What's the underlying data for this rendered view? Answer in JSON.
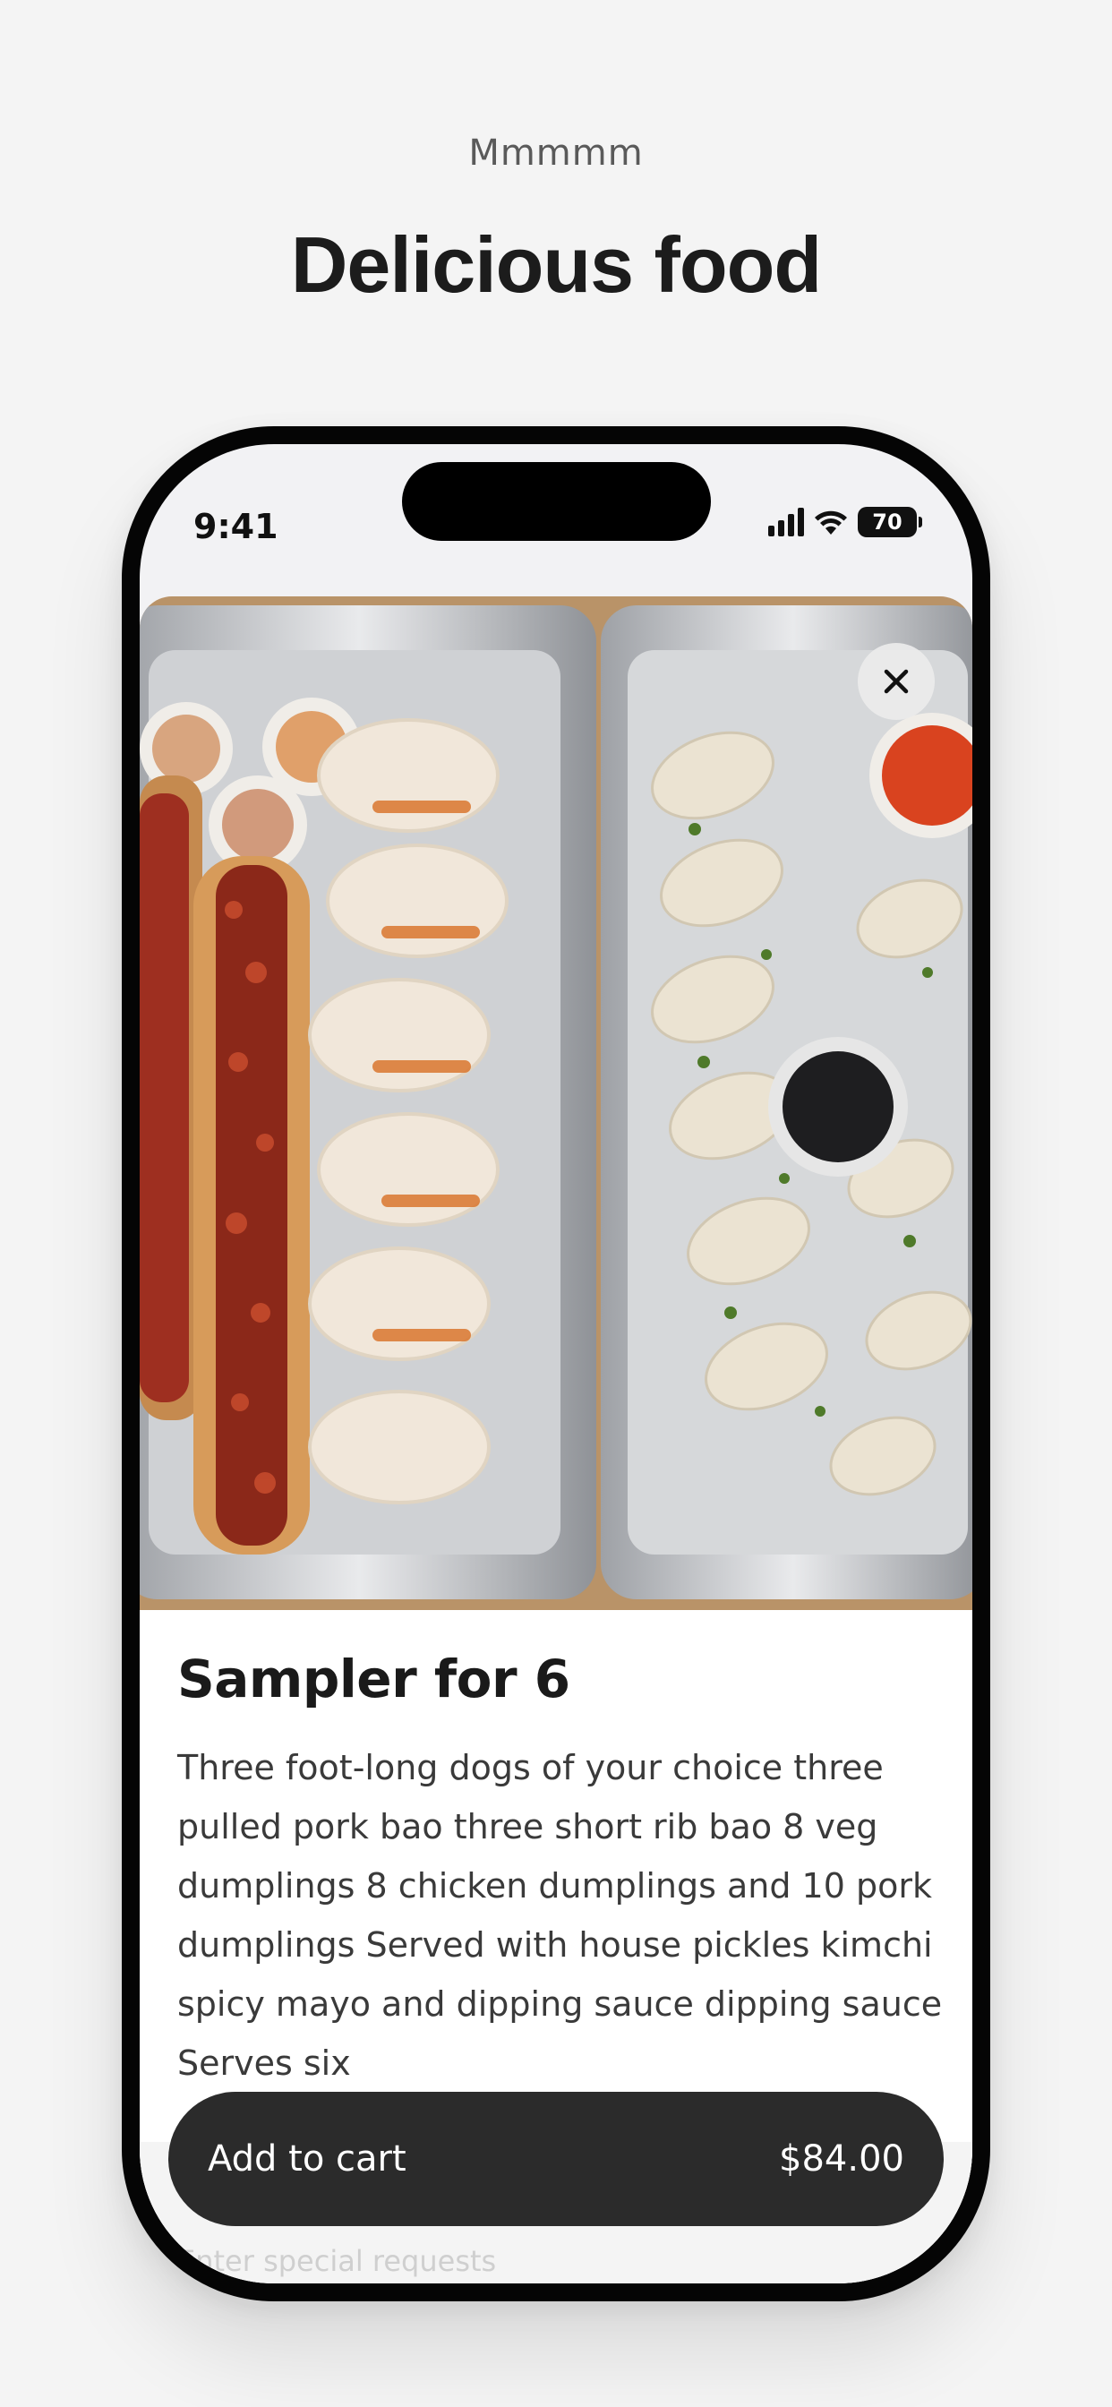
{
  "header": {
    "eyebrow": "Mmmmm",
    "title": "Delicious food"
  },
  "status_bar": {
    "time": "9:41",
    "battery": "70",
    "icons": [
      "cellular-signal-icon",
      "wifi-icon",
      "battery-icon"
    ]
  },
  "item": {
    "photo": "food-photo",
    "title": "Sampler for 6",
    "description": "Three foot-long dogs of your choice three pulled pork bao three short rib bao 8 veg dumplings 8 chicken dumplings and 10 pork dumplings Served with house pickles kimchi spicy mayo and dipping sauce dipping sauce Serves six",
    "close_icon": "close-icon"
  },
  "cart": {
    "label": "Add to cart",
    "price": "$84.00"
  },
  "special_requests": {
    "placeholder": "Enter special requests"
  },
  "colors": {
    "background": "#f4f4f4",
    "button": "#2b2b2b",
    "button_text": "#ffffff",
    "phone_frame": "#050505"
  }
}
